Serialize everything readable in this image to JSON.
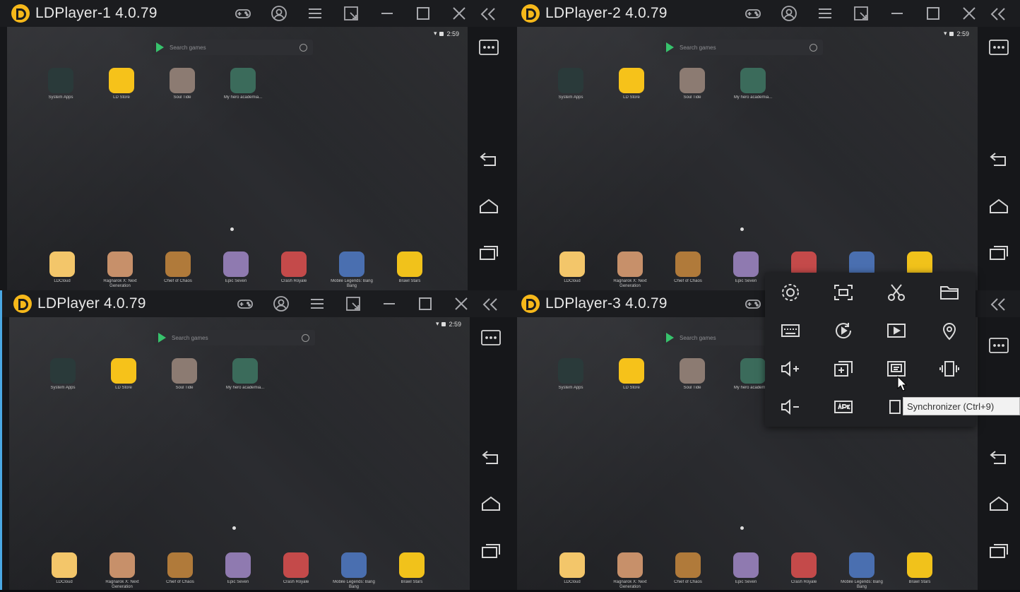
{
  "windows": [
    {
      "title": "LDPlayer-1 4.0.79"
    },
    {
      "title": "LDPlayer-2 4.0.79"
    },
    {
      "title": "LDPlayer 4.0.79"
    },
    {
      "title": "LDPlayer-3 4.0.79"
    }
  ],
  "status": {
    "time": "2:59"
  },
  "search": {
    "placeholder": "Search games"
  },
  "home_apps": [
    {
      "label": "System Apps",
      "icon": "system-apps-icon",
      "color": "#2a3a3a"
    },
    {
      "label": "LD Store",
      "icon": "ld-store-icon",
      "color": "#f6c21a"
    },
    {
      "label": "Soul Tide",
      "icon": "soul-tide-icon",
      "color": "#8c7b72"
    },
    {
      "label": "My hero academia...",
      "icon": "my-hero-academia-icon",
      "color": "#3b6b5b"
    }
  ],
  "dock_apps": [
    {
      "label": "LDCloud",
      "icon": "ldcloud-icon",
      "color": "#f3c66a"
    },
    {
      "label": "Ragnarok X: Next Generation",
      "icon": "ragnarok-icon",
      "color": "#c7906a"
    },
    {
      "label": "Chief of Chaos",
      "icon": "chief-of-chaos-icon",
      "color": "#b07a3a"
    },
    {
      "label": "Epic Seven",
      "icon": "epic-seven-icon",
      "color": "#8f7ab0"
    },
    {
      "label": "Crash Royale",
      "icon": "crash-royale-icon",
      "color": "#c44a4a"
    },
    {
      "label": "Mobile Legends: Bang Bang",
      "icon": "mobile-legends-icon",
      "color": "#4a6fb0"
    },
    {
      "label": "Brawl Stars",
      "icon": "brawl-stars-icon",
      "color": "#f1c21b"
    }
  ],
  "popup": {
    "tooltip": "Synchronizer (Ctrl+9)"
  },
  "colors": {
    "accent": "#f6b81a",
    "border_selected": "#4aa8e4"
  }
}
